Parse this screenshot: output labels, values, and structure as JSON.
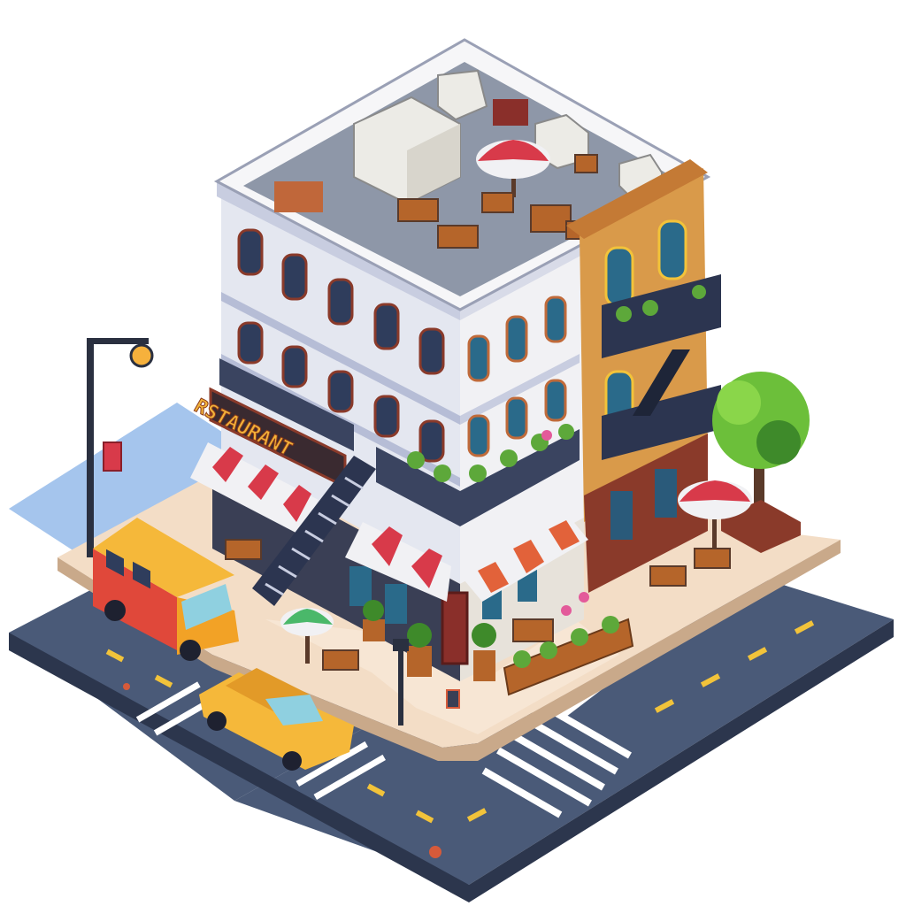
{
  "scene": {
    "restaurant_sign": "RSTAURANT"
  },
  "colors": {
    "asphalt": "#4a5a78",
    "sidewalk": "#f3ddc6",
    "building_white": "#e9ecf3",
    "building_orange": "#d99a4a",
    "awning_red": "#d83a4a",
    "van_orange": "#f2a226",
    "taxi_yellow": "#f5b83a",
    "tree_green": "#6cbf3a",
    "sign_gold": "#f2b33a"
  }
}
